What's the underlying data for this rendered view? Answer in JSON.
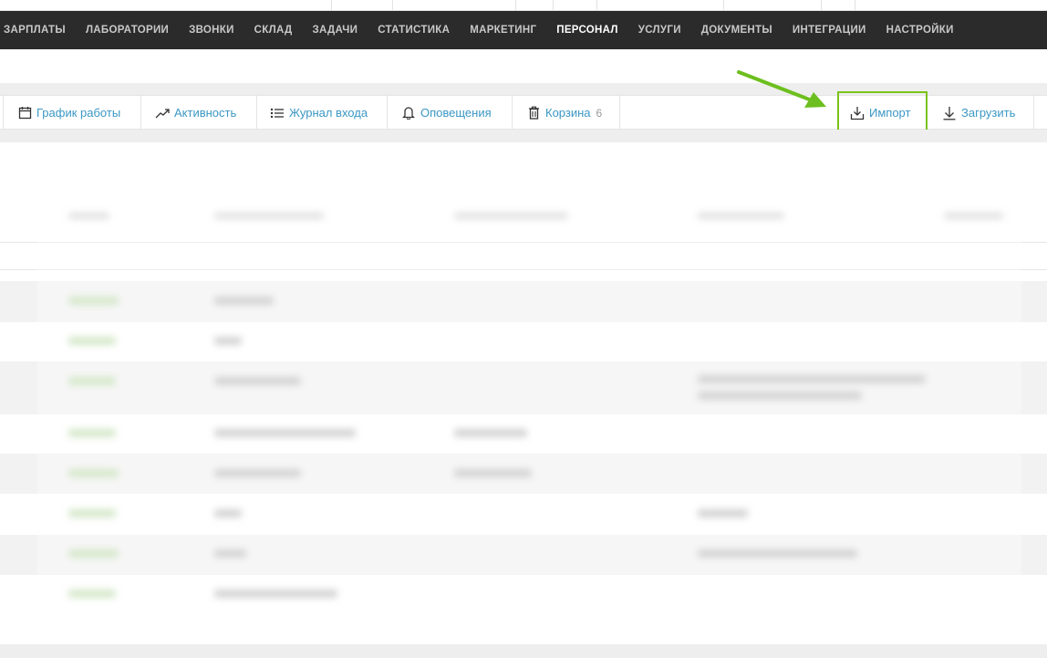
{
  "main_nav": {
    "items": [
      {
        "label": "ЗАРПЛАТЫ"
      },
      {
        "label": "ЛАБОРАТОРИИ"
      },
      {
        "label": "ЗВОНКИ"
      },
      {
        "label": "СКЛАД"
      },
      {
        "label": "ЗАДАЧИ"
      },
      {
        "label": "СТАТИСТИКА"
      },
      {
        "label": "МАРКЕТИНГ"
      },
      {
        "label": "ПЕРСОНАЛ",
        "active": true
      },
      {
        "label": "УСЛУГИ"
      },
      {
        "label": "ДОКУМЕНТЫ"
      },
      {
        "label": "ИНТЕГРАЦИИ"
      },
      {
        "label": "НАСТРОЙКИ"
      }
    ]
  },
  "toolbar": {
    "schedule": {
      "label": "График работы",
      "icon": "calendar-icon"
    },
    "activity": {
      "label": "Активность",
      "icon": "trend-icon"
    },
    "login_log": {
      "label": "Журнал входа",
      "icon": "list-icon"
    },
    "notifications": {
      "label": "Оповещения",
      "icon": "bell-icon"
    },
    "trash": {
      "label": "Корзина",
      "count": "6",
      "icon": "trash-icon"
    },
    "import": {
      "label": "Импорт",
      "icon": "import-icon"
    },
    "upload": {
      "label": "Загрузить",
      "icon": "download-icon"
    }
  },
  "colors": {
    "nav_bg": "#2b2b2b",
    "link": "#3b97c4",
    "highlight": "#7cc21a"
  }
}
